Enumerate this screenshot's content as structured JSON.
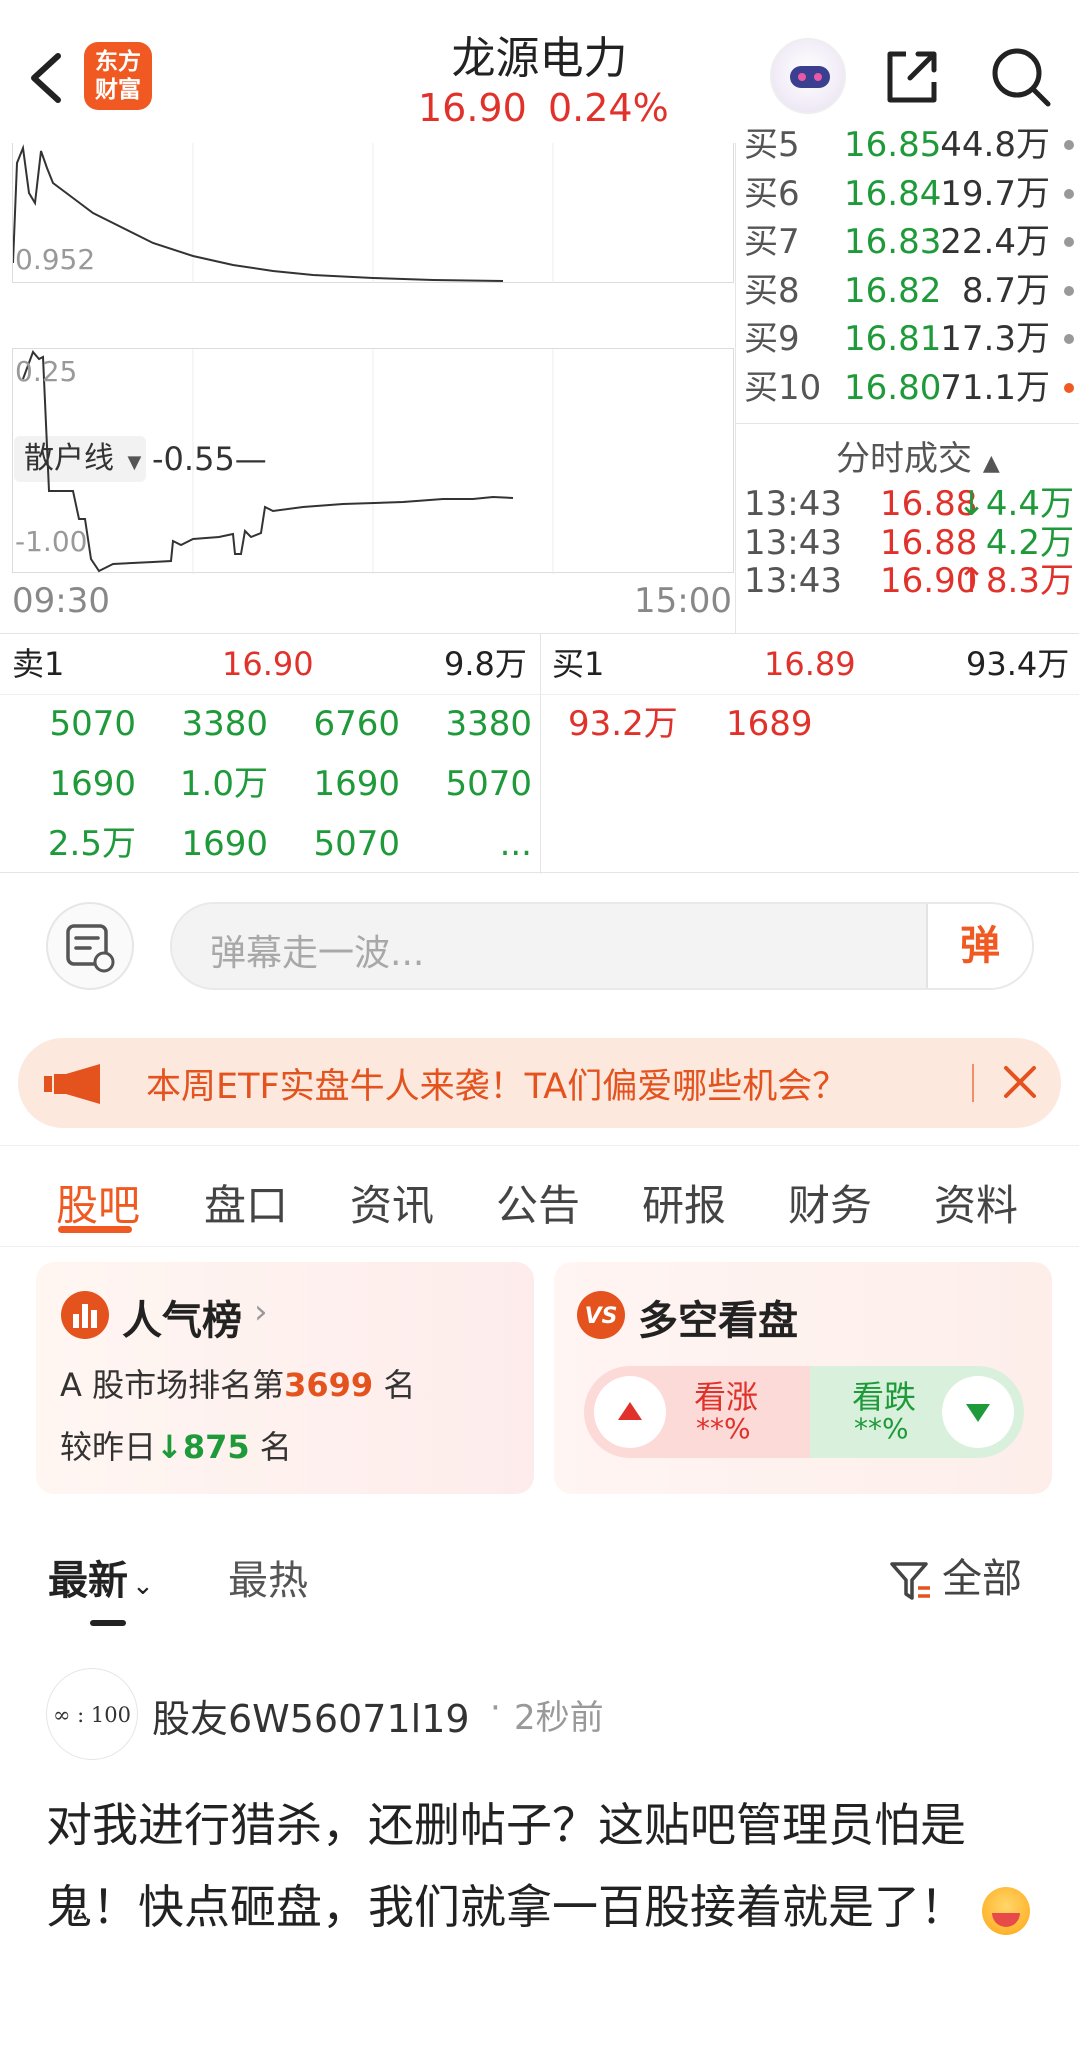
{
  "header": {
    "logo_top": "东方",
    "logo_bottom": "财富",
    "stock_name": "龙源电力",
    "price": "16.90",
    "change_pct": "0.24%"
  },
  "chart": {
    "upper_min_label": "0.952",
    "indicator_name": "散户线",
    "indicator_value": "-0.55—",
    "lower_top_label": "0.25",
    "lower_bottom_label": "-1.00",
    "time_start": "09:30",
    "time_end": "15:00"
  },
  "order_book": {
    "rows": [
      {
        "label": "买5",
        "price": "16.85",
        "volume": "44.8万",
        "dot": "#999999"
      },
      {
        "label": "买6",
        "price": "16.84",
        "volume": "19.7万",
        "dot": "#999999"
      },
      {
        "label": "买7",
        "price": "16.83",
        "volume": "22.4万",
        "dot": "#999999"
      },
      {
        "label": "买8",
        "price": "16.82",
        "volume": "8.7万",
        "dot": "#999999"
      },
      {
        "label": "买9",
        "price": "16.81",
        "volume": "17.3万",
        "dot": "#999999"
      },
      {
        "label": "买10",
        "price": "16.80",
        "volume": "71.1万",
        "dot": "#f05a22"
      }
    ],
    "trades_title": "分时成交",
    "trades": [
      {
        "time": "13:43",
        "price": "16.88",
        "arrow": "↓",
        "volume": "4.4万",
        "color": "#1f9a3a"
      },
      {
        "time": "13:43",
        "price": "16.88",
        "arrow": "",
        "volume": "4.2万",
        "color": "#1f9a3a"
      },
      {
        "time": "13:43",
        "price": "16.90",
        "arrow": "↑",
        "volume": "8.3万",
        "color": "#e0322b"
      }
    ]
  },
  "queue": {
    "sell_label": "卖1",
    "sell_price": "16.90",
    "sell_volume": "9.8万",
    "buy_label": "买1",
    "buy_price": "16.89",
    "buy_volume": "93.4万",
    "sell_cells": [
      [
        "5070",
        "3380",
        "6760",
        "3380"
      ],
      [
        "1690",
        "1.0万",
        "1690",
        "5070"
      ],
      [
        "2.5万",
        "1690",
        "5070",
        "..."
      ]
    ],
    "buy_cells": [
      "93.2万",
      "1689"
    ]
  },
  "danmu": {
    "placeholder": "弹幕走一波...",
    "send_label": "弹"
  },
  "promo": {
    "text": "本周ETF实盘牛人来袭！TA们偏爱哪些机会？"
  },
  "tabs": [
    "股吧",
    "盘口",
    "资讯",
    "公告",
    "研报",
    "财务",
    "资料"
  ],
  "popularity": {
    "title": "人气榜",
    "rank_prefix": "A 股市场排名第",
    "rank_value": "3699",
    "rank_suffix": "名",
    "change_prefix": "较昨日",
    "change_value": "875",
    "change_suffix": "名"
  },
  "sentiment": {
    "title": "多空看盘",
    "up_label": "看涨",
    "up_value": "**%",
    "down_label": "看跌",
    "down_value": "**%"
  },
  "feed": {
    "latest": "最新",
    "hottest": "最热",
    "filter": "全部"
  },
  "post": {
    "avatar_text": "∞ : 100",
    "author": "股友6W56071l19",
    "time": "2秒前",
    "text": "对我进行猎杀，还删帖子？这贴吧管理员怕是鬼！快点砸盘，我们就拿一百股接着就是了！"
  },
  "colors": {
    "accent": "#f05a22",
    "up": "#e0322b",
    "down": "#1f9a3a"
  }
}
